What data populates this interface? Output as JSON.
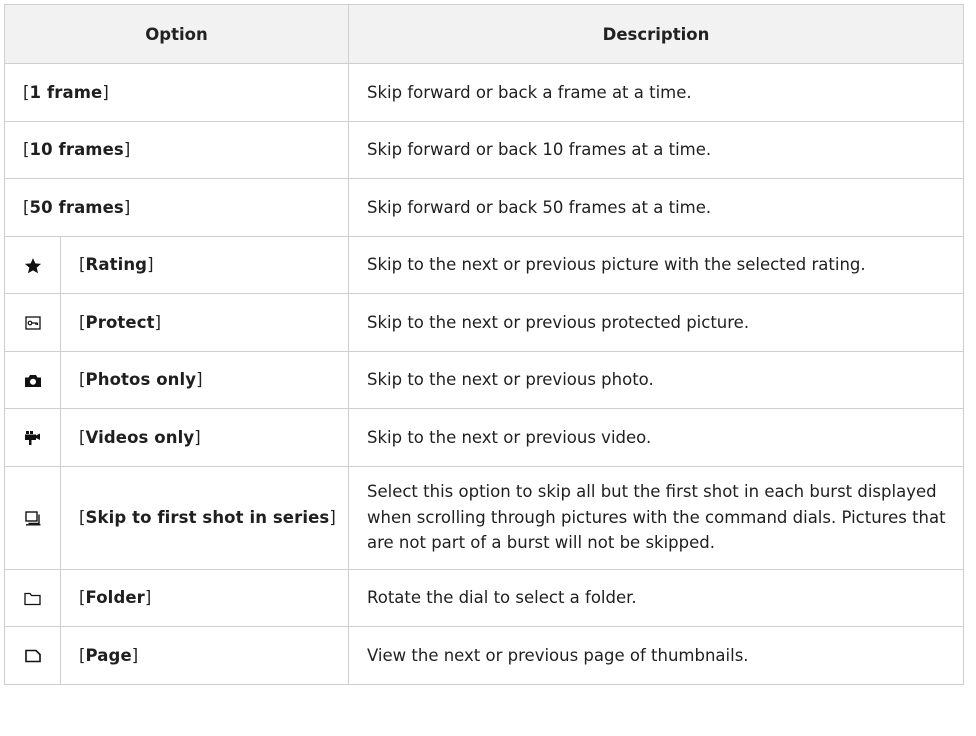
{
  "table": {
    "headers": {
      "option": "Option",
      "description": "Description"
    },
    "rows": [
      {
        "icon": "",
        "label": "1 frame",
        "description": "Skip forward or back a frame at a time."
      },
      {
        "icon": "",
        "label": "10 frames",
        "description": "Skip forward or back 10 frames at a time."
      },
      {
        "icon": "",
        "label": "50 frames",
        "description": "Skip forward or back 50 frames at a time."
      },
      {
        "icon": "star-icon",
        "label": "Rating",
        "description": "Skip to the next or previous picture with the selected rating."
      },
      {
        "icon": "protect-key-icon",
        "label": "Protect",
        "description": "Skip to the next or previous protected picture."
      },
      {
        "icon": "camera-icon",
        "label": "Photos only",
        "description": "Skip to the next or previous photo."
      },
      {
        "icon": "movie-camera-icon",
        "label": "Videos only",
        "description": "Skip to the next or previous video."
      },
      {
        "icon": "burst-series-icon",
        "label": "Skip to first shot in series",
        "description": "Select this option to skip all but the first shot in each burst displayed when scrolling through pictures with the command dials. Pictures that are not part of a burst will not be skipped."
      },
      {
        "icon": "folder-icon",
        "label": "Folder",
        "description": "Rotate the dial to select a folder."
      },
      {
        "icon": "page-icon",
        "label": "Page",
        "description": "View the next or previous page of thumbnails."
      }
    ]
  }
}
